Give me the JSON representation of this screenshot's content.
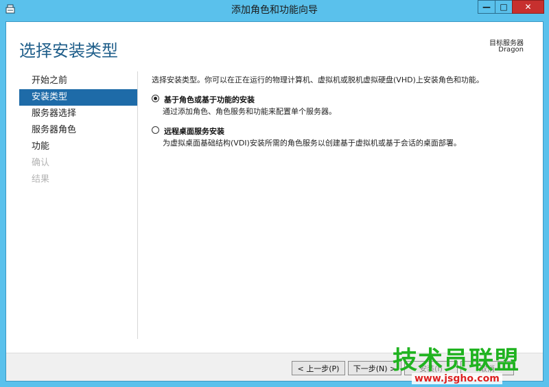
{
  "window": {
    "title": "添加角色和功能向导",
    "minimize_glyph": "—",
    "maximize_glyph": "□",
    "close_glyph": "✕"
  },
  "header": {
    "page_title": "选择安装类型",
    "target_label": "目标服务器",
    "target_value": "Dragon"
  },
  "nav": {
    "items": [
      {
        "label": "开始之前",
        "state": "normal"
      },
      {
        "label": "安装类型",
        "state": "active"
      },
      {
        "label": "服务器选择",
        "state": "normal"
      },
      {
        "label": "服务器角色",
        "state": "normal"
      },
      {
        "label": "功能",
        "state": "normal"
      },
      {
        "label": "确认",
        "state": "disabled"
      },
      {
        "label": "结果",
        "state": "disabled"
      }
    ]
  },
  "content": {
    "intro": "选择安装类型。你可以在正在运行的物理计算机、虚拟机或脱机虚拟硬盘(VHD)上安装角色和功能。",
    "options": [
      {
        "label": "基于角色或基于功能的安装",
        "description": "通过添加角色、角色服务和功能来配置单个服务器。",
        "selected": true
      },
      {
        "label": "远程桌面服务安装",
        "description": "为虚拟桌面基础结构(VDI)安装所需的角色服务以创建基于虚拟机或基于会话的桌面部署。",
        "selected": false
      }
    ]
  },
  "footer": {
    "prev_label": "< 上一步(P)",
    "next_label": "下一步(N) >",
    "install_label": "安装(I)",
    "cancel_label": "取消"
  },
  "watermark": {
    "text": "技术员联盟",
    "url": "www.jsgho.com"
  },
  "colors": {
    "titlebar": "#5ac1ec",
    "accent": "#1e6ba8",
    "title_text": "#1f5e8a",
    "close": "#c7302e",
    "watermark_green": "#20b320",
    "watermark_red": "#dd2222"
  }
}
